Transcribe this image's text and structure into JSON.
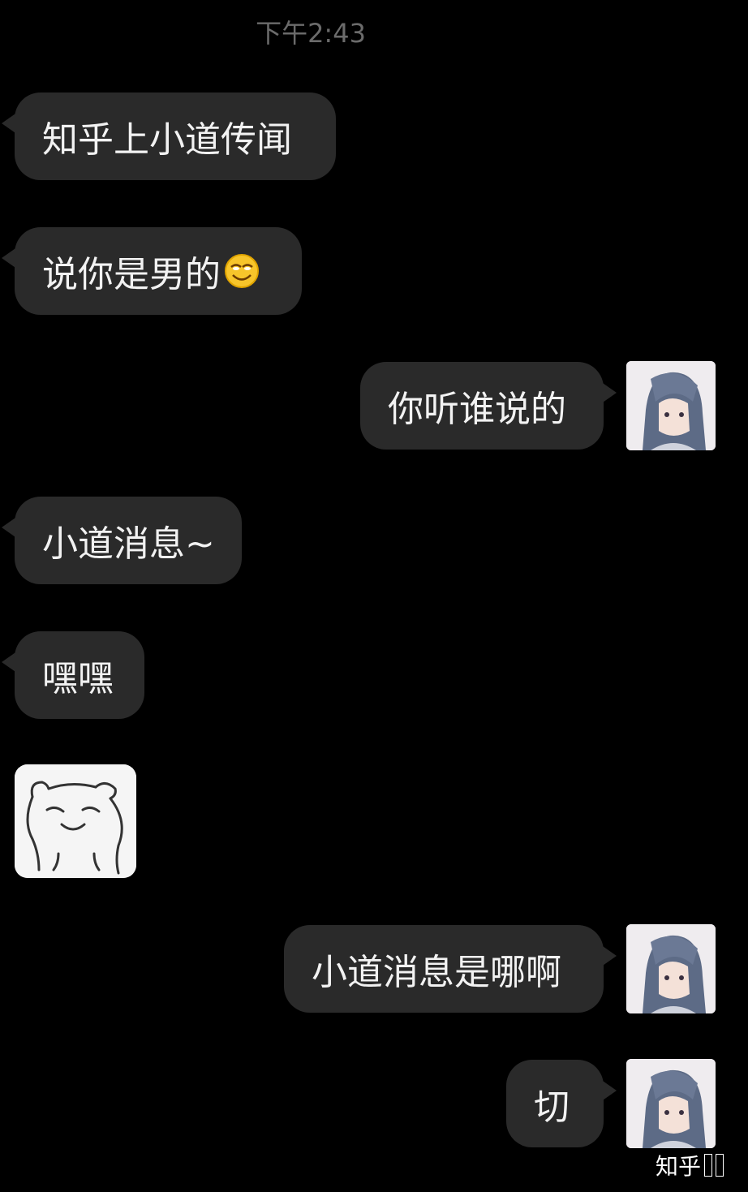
{
  "status": {
    "time": "下午2:43"
  },
  "messages": [
    {
      "side": "left",
      "text": "知乎上小道传闻"
    },
    {
      "side": "left",
      "text": "说你是男的",
      "emoji": "grinning-squint-emoji"
    },
    {
      "side": "right",
      "text": "你听谁说的",
      "avatar": "anime-girl-avatar"
    },
    {
      "side": "left",
      "text": "小道消息~"
    },
    {
      "side": "left",
      "text": "嘿嘿"
    },
    {
      "side": "left",
      "sticker": "smug-bear-sticker"
    },
    {
      "side": "right",
      "text": "小道消息是哪啊",
      "avatar": "anime-girl-avatar"
    },
    {
      "side": "right",
      "text": "切",
      "avatar": "anime-girl-avatar"
    }
  ],
  "watermark": {
    "text": "知乎"
  },
  "colors": {
    "background": "#000000",
    "bubble": "#2a2a2a",
    "text": "#f2f2f2",
    "timestamp": "#6b6b6b"
  }
}
